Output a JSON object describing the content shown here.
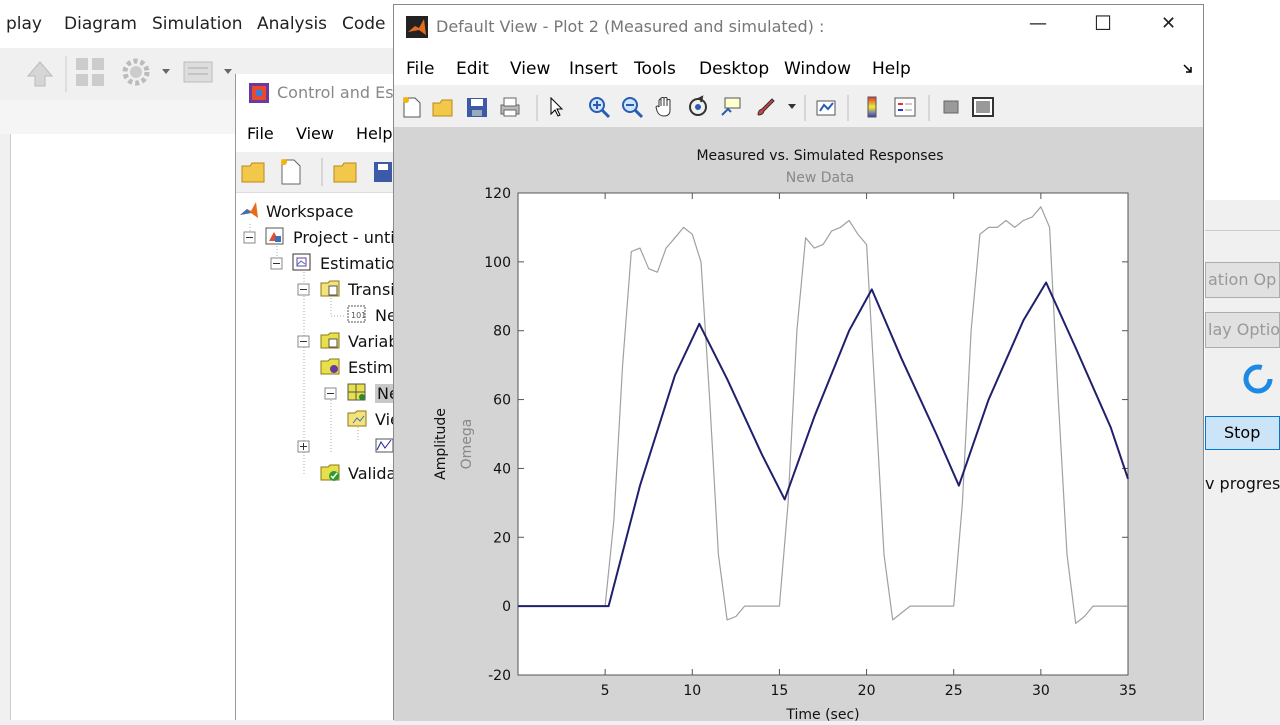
{
  "simulink": {
    "menu": [
      "play",
      "Diagram",
      "Simulation",
      "Analysis",
      "Code"
    ]
  },
  "right_panel": {
    "button1": "ation Op",
    "button2": "lay Optio",
    "stop": "Stop",
    "progress_text": "v progres"
  },
  "cet": {
    "title": "Control and Est",
    "menu": [
      "File",
      "View",
      "Help"
    ],
    "tree": [
      {
        "label": "Workspace"
      },
      {
        "label": "Project - unti"
      },
      {
        "label": "Estimation"
      },
      {
        "label": "Transi"
      },
      {
        "label": "Ne"
      },
      {
        "label": "Variab"
      },
      {
        "label": "Estima"
      },
      {
        "label": "Ne"
      },
      {
        "label": "Vie"
      },
      {
        "label": "Valida"
      }
    ]
  },
  "figure": {
    "title": "Default View - Plot 2 (Measured and simulated) :",
    "menu": [
      "File",
      "Edit",
      "View",
      "Insert",
      "Tools",
      "Desktop",
      "Window",
      "Help"
    ],
    "window_controls": {
      "minimize": "—",
      "maximize": "☐",
      "close": "✕"
    }
  },
  "chart_data": {
    "type": "line",
    "title": "Measured vs. Simulated Responses",
    "subtitle": "New Data",
    "xlabel": "Time (sec)",
    "ylabel": "Amplitude",
    "ylabel2": "Omega",
    "xlim": [
      0,
      35
    ],
    "ylim": [
      -20,
      120
    ],
    "xticks": [
      5,
      10,
      15,
      20,
      25,
      30,
      35
    ],
    "yticks": [
      -20,
      0,
      20,
      40,
      60,
      80,
      100,
      120
    ],
    "grid": false,
    "series": [
      {
        "color": "#a0a0a0",
        "x": [
          0,
          5,
          5.5,
          6,
          6.5,
          7,
          7.5,
          8,
          8.5,
          9,
          9.5,
          10,
          10.5,
          11,
          11.5,
          12,
          12.5,
          13,
          14,
          15,
          15.5,
          16,
          16.5,
          17,
          17.5,
          18,
          18.5,
          19,
          19.5,
          20,
          20.5,
          21,
          21.5,
          22,
          22.5,
          23,
          24,
          25,
          25.5,
          26,
          26.5,
          27,
          27.5,
          28,
          28.5,
          29,
          29.5,
          30,
          30.5,
          31,
          31.5,
          32,
          32.5,
          33,
          34,
          35
        ],
        "y": [
          0,
          0,
          25,
          70,
          103,
          104,
          98,
          97,
          104,
          107,
          110,
          108,
          100,
          60,
          15,
          -4,
          -3,
          0,
          0,
          0,
          30,
          80,
          107,
          104,
          105,
          109,
          110,
          112,
          108,
          105,
          60,
          15,
          -4,
          -2,
          0,
          0,
          0,
          0,
          30,
          80,
          108,
          110,
          110,
          112,
          110,
          112,
          113,
          116,
          110,
          60,
          15,
          -5,
          -3,
          0,
          0,
          0
        ]
      },
      {
        "color": "#1f1f6e",
        "x": [
          0,
          5,
          5.2,
          7,
          9,
          10.4,
          12,
          14,
          15.3,
          17,
          19,
          20.3,
          22,
          24,
          25.3,
          27,
          29,
          30.3,
          32,
          34,
          35
        ],
        "y": [
          0,
          0,
          0,
          35,
          67,
          82,
          66,
          44,
          31,
          55,
          80,
          92,
          72,
          50,
          35,
          60,
          83,
          94,
          75,
          52,
          37
        ]
      }
    ]
  }
}
